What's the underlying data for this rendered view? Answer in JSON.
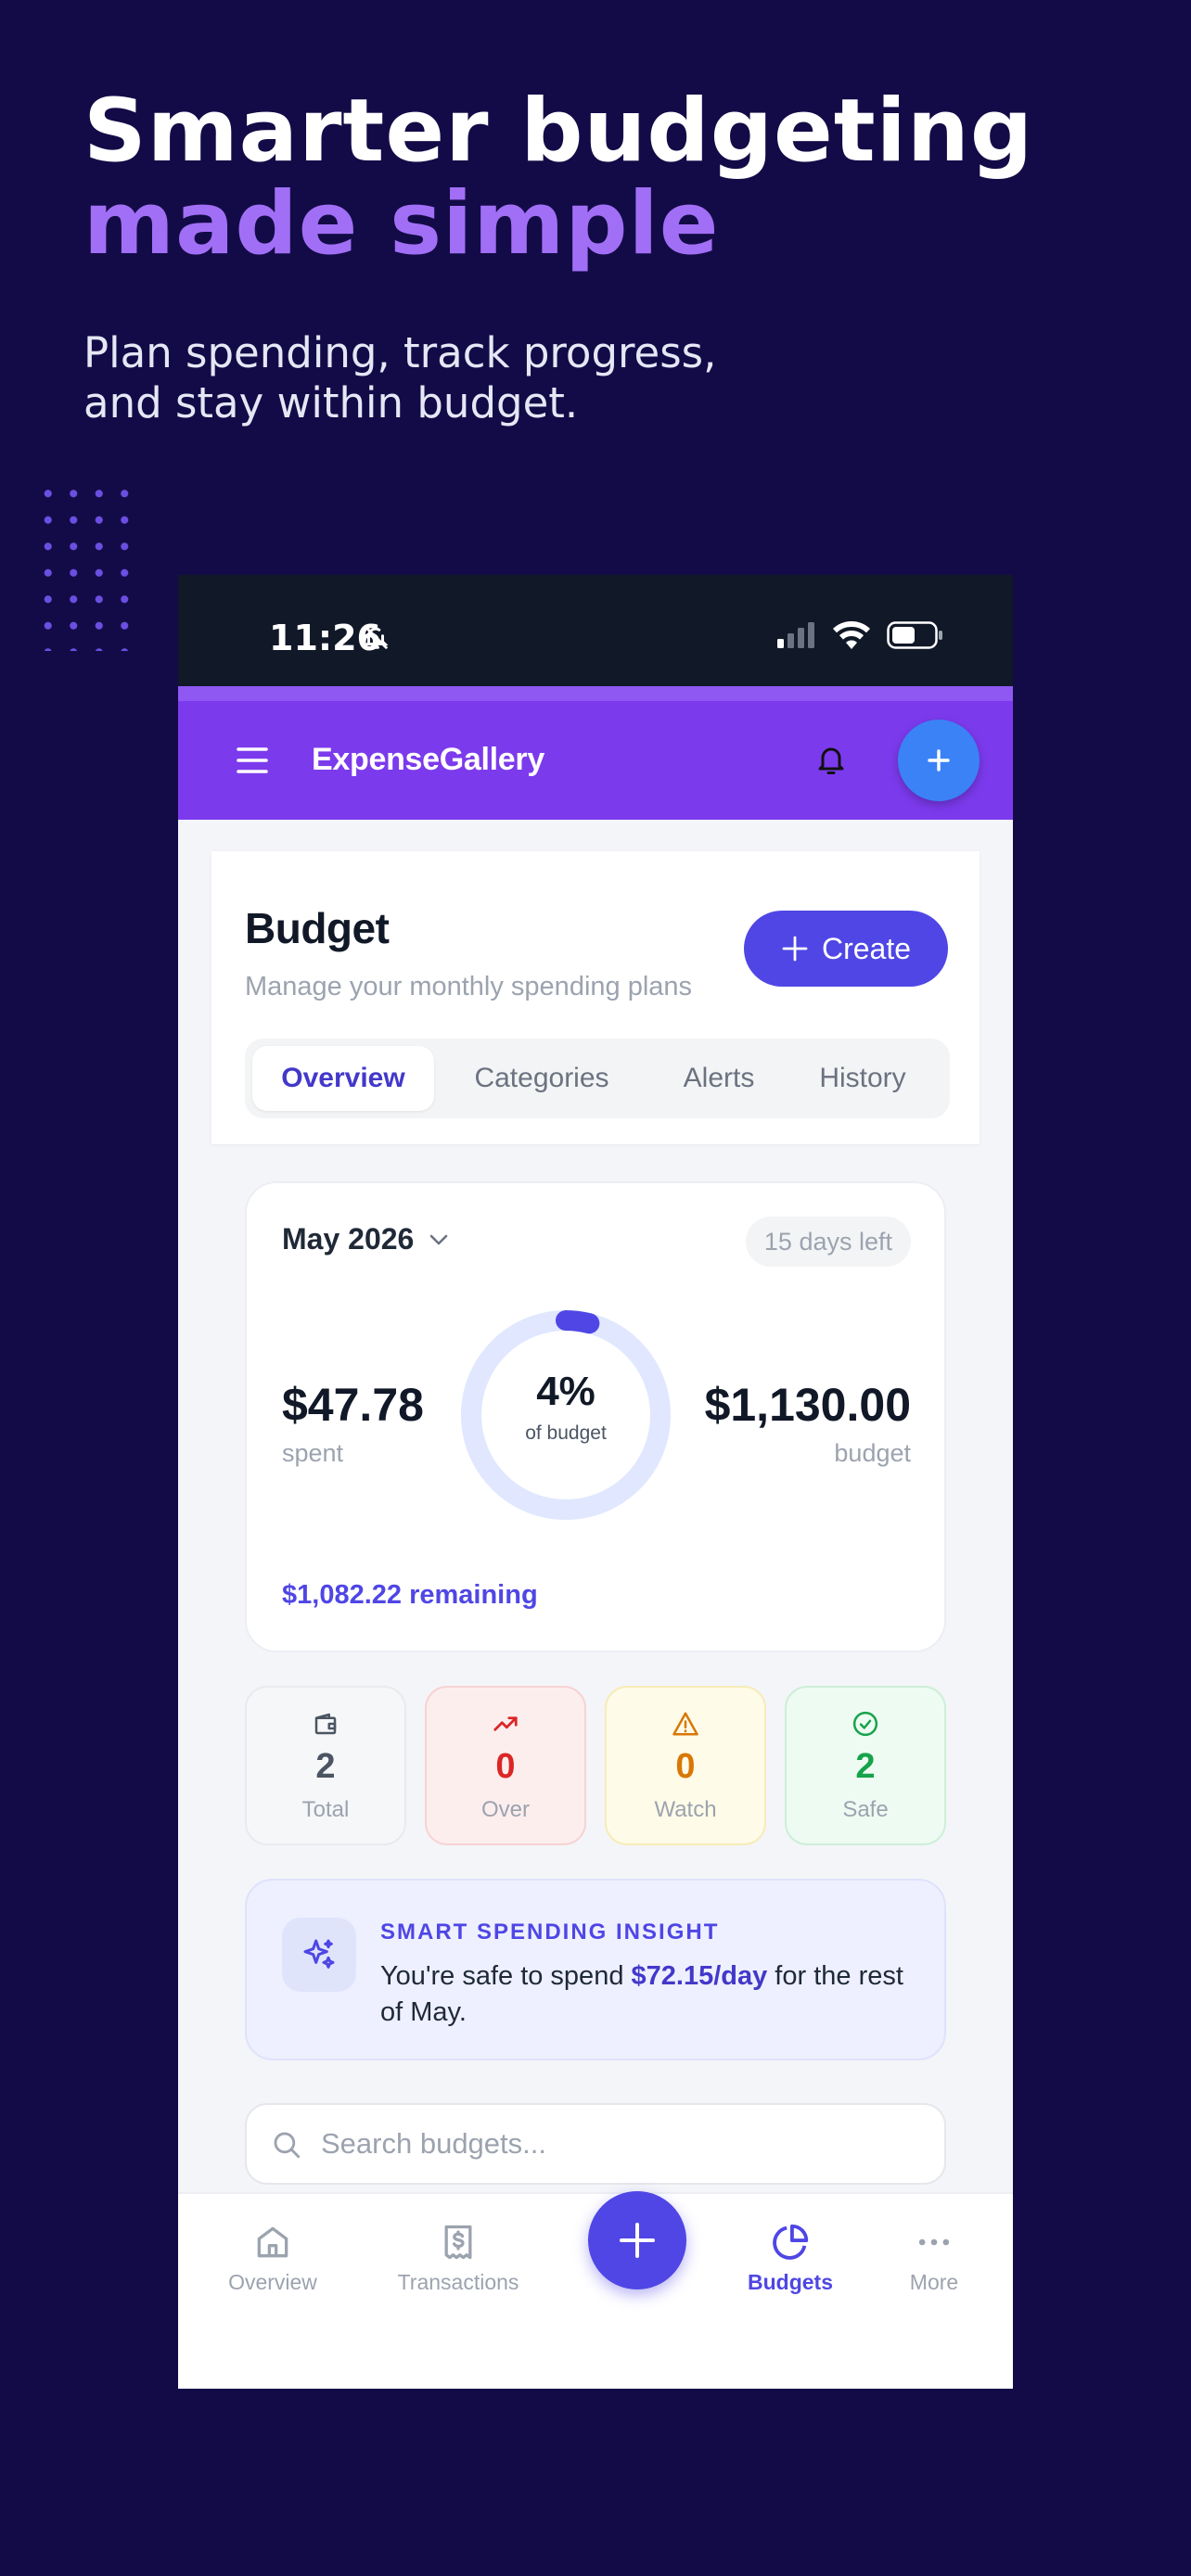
{
  "hero": {
    "title_line1": "Smarter budgeting",
    "title_line2": "made simple",
    "subtitle": "Plan spending, track progress,\nand stay within budget."
  },
  "status_bar": {
    "time": "11:26"
  },
  "app_bar": {
    "brand": "ExpenseGallery"
  },
  "header": {
    "title": "Budget",
    "subtitle": "Manage your monthly spending plans",
    "create_label": "Create",
    "tabs": [
      {
        "label": "Overview",
        "active": true
      },
      {
        "label": "Categories",
        "active": false
      },
      {
        "label": "Alerts",
        "active": false
      },
      {
        "label": "History",
        "active": false
      }
    ]
  },
  "budget_card": {
    "month": "May 2026",
    "days_left": "15 days left",
    "spent": "$47.78",
    "spent_label": "spent",
    "percent": "4%",
    "percent_value": 0.04,
    "percent_label": "of budget",
    "budget": "$1,130.00",
    "budget_label": "budget",
    "remaining": "$1,082.22 remaining"
  },
  "stats": [
    {
      "icon": "wallet-icon",
      "value": "2",
      "label": "Total",
      "color": "#4b5563",
      "bg": "#f6f7f9",
      "border": "#e8eaee"
    },
    {
      "icon": "trending-up-icon",
      "value": "0",
      "label": "Over",
      "color": "#dc2626",
      "bg": "#fdeeee",
      "border": "#f7d3d3"
    },
    {
      "icon": "warning-icon",
      "value": "0",
      "label": "Watch",
      "color": "#d97706",
      "bg": "#fefbe8",
      "border": "#f6ecb8"
    },
    {
      "icon": "check-circle-icon",
      "value": "2",
      "label": "Safe",
      "color": "#16a34a",
      "bg": "#eefbf2",
      "border": "#ccefd8"
    }
  ],
  "insight": {
    "heading": "SMART SPENDING INSIGHT",
    "text_before": "You're safe to spend ",
    "highlight": "$72.15/day",
    "text_after": " for the rest of May."
  },
  "search": {
    "placeholder": "Search budgets..."
  },
  "bottom_nav": [
    {
      "icon": "home-icon",
      "label": "Overview",
      "active": false
    },
    {
      "icon": "receipt-icon",
      "label": "Transactions",
      "active": false
    },
    {
      "icon": "pie-chart-icon",
      "label": "Budgets",
      "active": true
    },
    {
      "icon": "more-icon",
      "label": "More",
      "active": false
    }
  ],
  "colors": {
    "background": "#130b47",
    "accent": "#a16ff5",
    "primary": "#4f46e5",
    "app_bar": "#7c3aed"
  }
}
